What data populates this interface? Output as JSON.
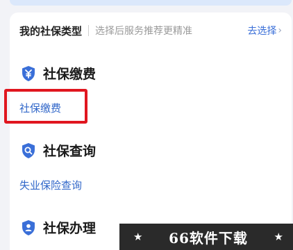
{
  "type_bar": {
    "title": "我的社保类型",
    "hint": "选择后服务推荐更精准",
    "action": "去选择"
  },
  "sections": [
    {
      "icon": "yuan-shield-icon",
      "title": "社保缴费",
      "link": "社保缴费"
    },
    {
      "icon": "search-shield-icon",
      "title": "社保查询",
      "link": "失业保险查询"
    },
    {
      "icon": "person-shield-icon",
      "title": "社保办理"
    }
  ],
  "watermark": {
    "text": "66软件下载",
    "star": "★"
  },
  "colors": {
    "accent": "#3a6fd8",
    "link": "#3167c9",
    "highlight_box": "#e0161f",
    "background": "#f2f3f7"
  }
}
